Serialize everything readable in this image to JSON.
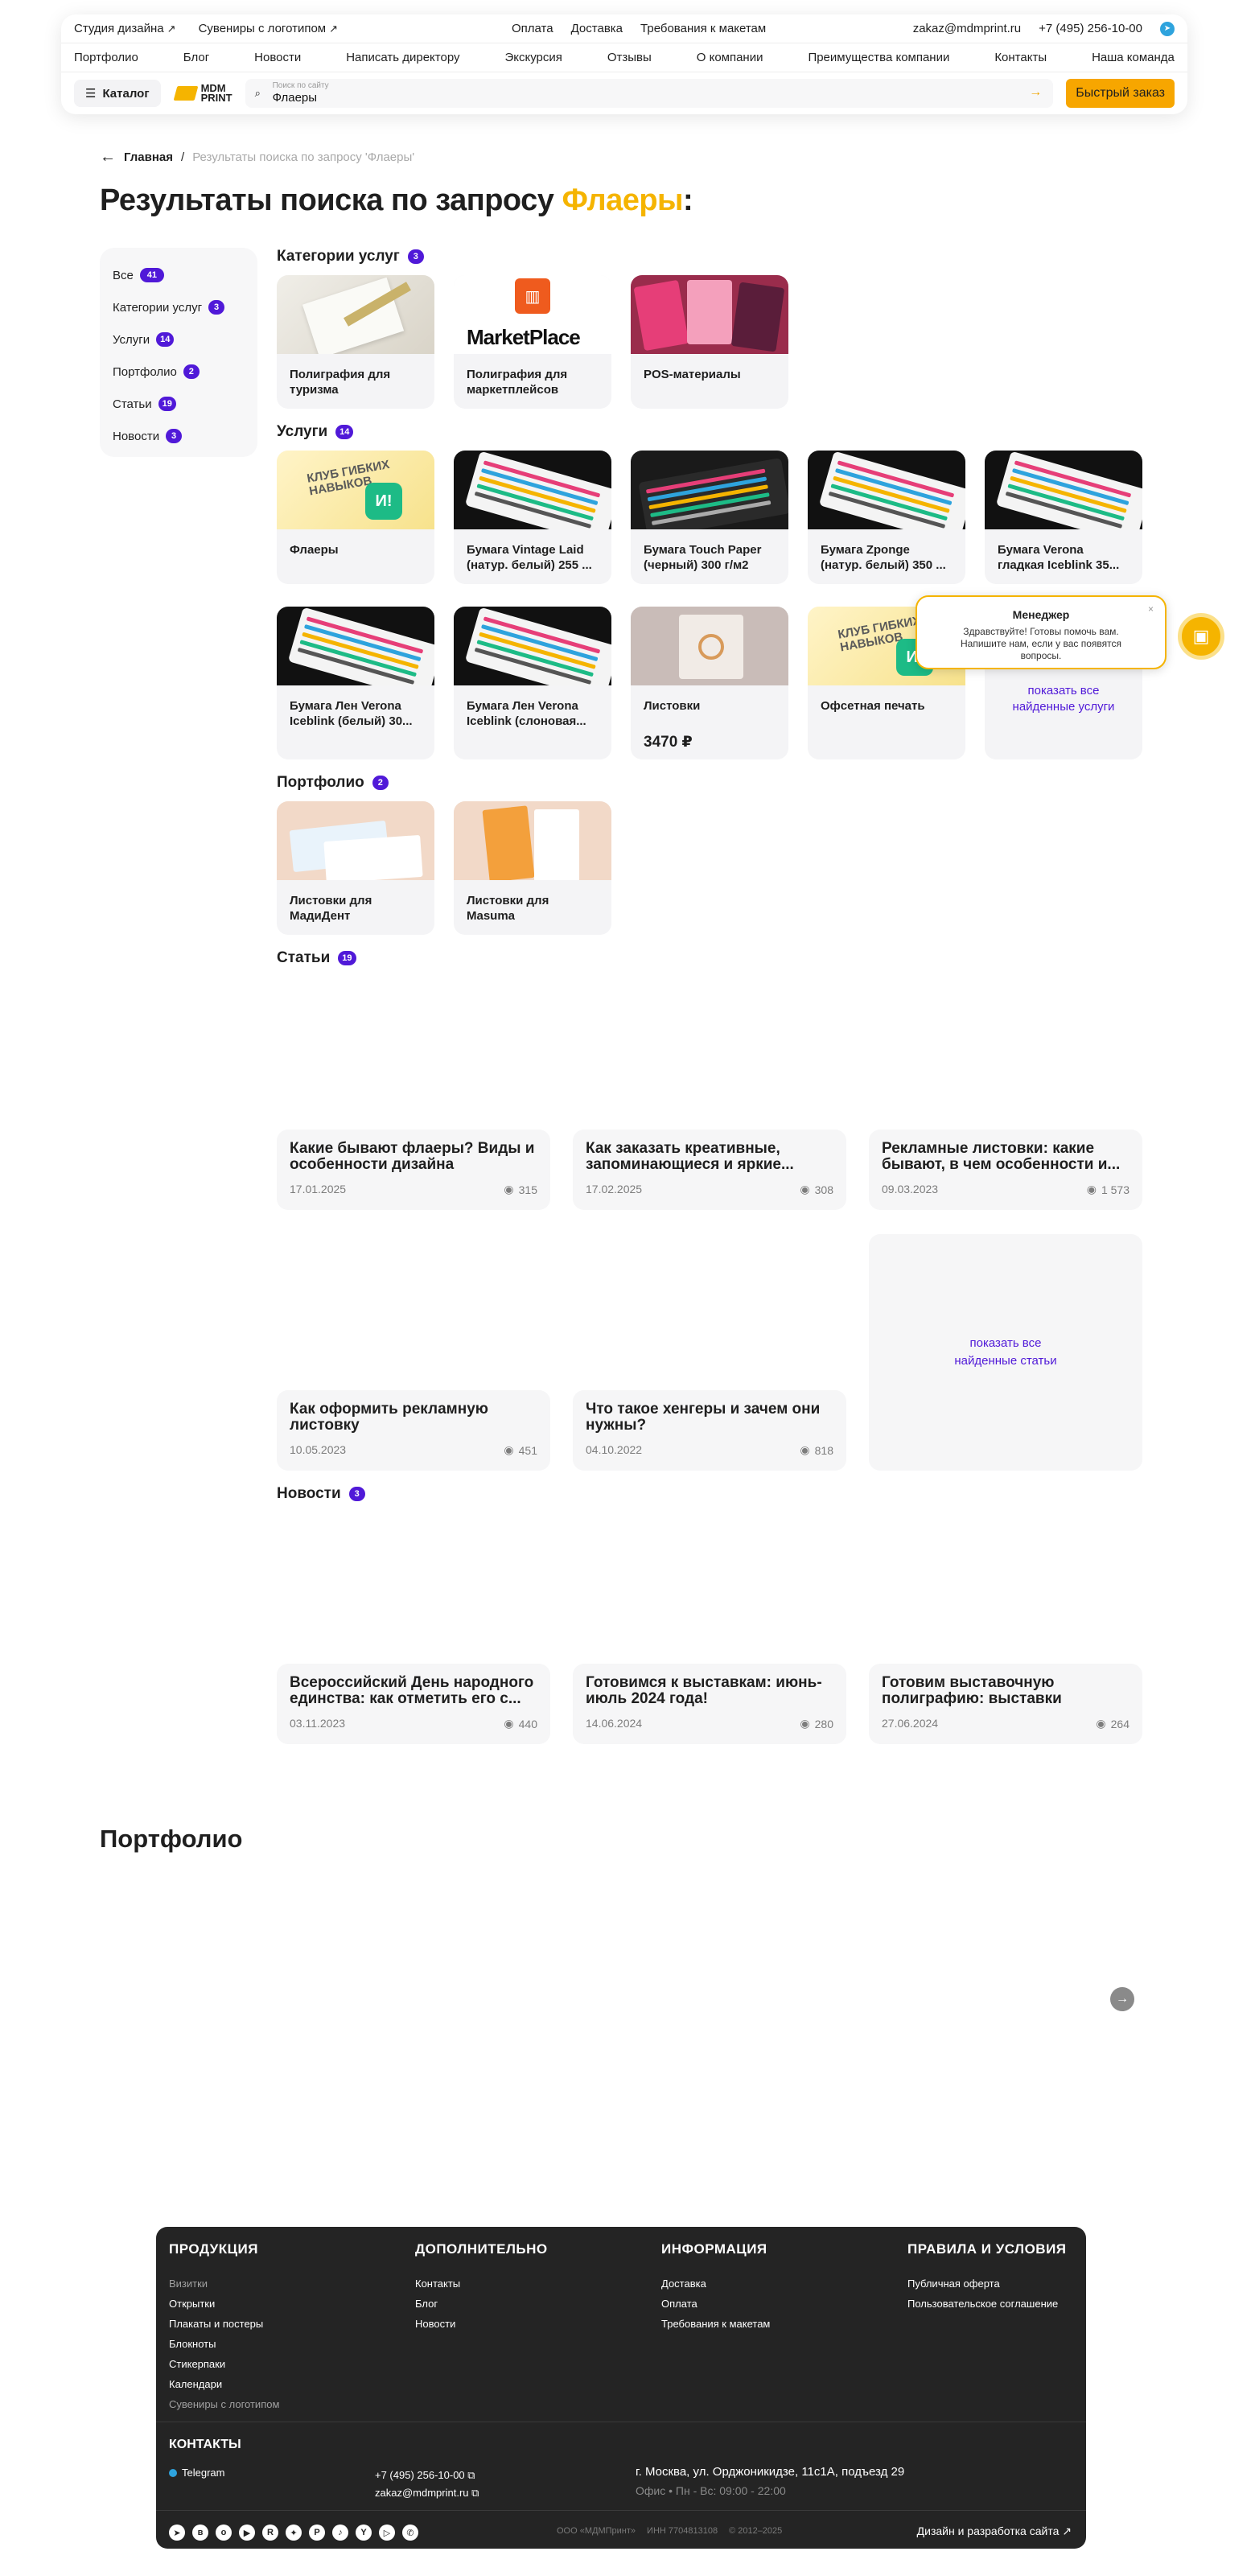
{
  "header": {
    "top_links": [
      {
        "label": "Студия дизайна",
        "arrow": "↗"
      },
      {
        "label": "Сувениры с логотипом",
        "arrow": "↗"
      }
    ],
    "top_center": [
      "Оплата",
      "Доставка",
      "Требования к макетам"
    ],
    "email": "zakaz@mdmprint.ru",
    "phone": "+7 (495) 256-10-00",
    "telegram_icon": "telegram-icon",
    "nav": [
      "Портфолио",
      "Блог",
      "Новости",
      "Написать директору",
      "Экскурсия",
      "Отзывы",
      "О компании",
      "Преимущества компании",
      "Контакты",
      "Наша команда"
    ],
    "catalog_label": "Каталог",
    "logo_text_1": "MDM",
    "logo_text_2": "PRINT",
    "search_placeholder": "Поиск по сайту",
    "search_value": "Флаеры",
    "quick_order_label": "Быстрый заказ",
    "accent_color": "#f7a600"
  },
  "breadcrumb": {
    "home": "Главная",
    "separator": "/",
    "current": "Результаты поиска по запросу 'Флаеры'"
  },
  "title": {
    "prefix": "Результаты поиска по запросу ",
    "query": "Флаеры",
    "suffix": ":"
  },
  "filters": [
    {
      "label": "Все",
      "count": "41"
    },
    {
      "label": "Категории услуг",
      "count": "3"
    },
    {
      "label": "Услуги",
      "count": "14"
    },
    {
      "label": "Портфолио",
      "count": "2"
    },
    {
      "label": "Статьи",
      "count": "19"
    },
    {
      "label": "Новости",
      "count": "3"
    }
  ],
  "categories": {
    "title": "Категории услуг",
    "count": "3",
    "items": [
      {
        "label": "Полиграфия для туризма"
      },
      {
        "label": "Полиграфия для маркетплейсов",
        "logo_text": "MarketPlace"
      },
      {
        "label": "POS-материалы"
      }
    ]
  },
  "services": {
    "title": "Услуги",
    "count": "14",
    "items": [
      {
        "label": "Флаеры"
      },
      {
        "label": "Бумага Vintage Laid (натур. белый) 255 ..."
      },
      {
        "label": "Бумага Touch Paper (черный) 300 г/м2"
      },
      {
        "label": "Бумага Zponge (натур. белый) 350 ..."
      },
      {
        "label": "Бумага Verona гладкая Iceblink 35..."
      },
      {
        "label": "Бумага Лен Verona Iceblink (белый) 30..."
      },
      {
        "label": "Бумага Лен Verona Iceblink (слоновая..."
      },
      {
        "label": "Листовки",
        "price": "3470 ₽"
      },
      {
        "label": "Офсетная печать"
      }
    ],
    "more_label": "показать все найденные услуги",
    "club_text": "КЛУБ ГИБКИХ НАВЫКОВ",
    "badge_text": "И!"
  },
  "portfolio": {
    "title": "Портфолио",
    "count": "2",
    "items": [
      {
        "label": "Листовки для МадиДент"
      },
      {
        "label": "Листовки для Masuma"
      }
    ]
  },
  "articles": {
    "title": "Статьи",
    "count": "19",
    "items": [
      {
        "title": "Какие бывают флаеры? Виды и особенности дизайна",
        "date": "17.01.2025",
        "views": "315"
      },
      {
        "title": "Как заказать креативные, запоминающиеся и яркие...",
        "date": "17.02.2025",
        "views": "308"
      },
      {
        "title": "Рекламные листовки: какие бывают, в чем особенности и...",
        "date": "09.03.2023",
        "views": "1 573"
      },
      {
        "title": "Как оформить рекламную листовку",
        "date": "10.05.2023",
        "views": "451"
      },
      {
        "title": "Что такое хенгеры и зачем они нужны?",
        "date": "04.10.2022",
        "views": "818"
      }
    ],
    "more_label": "показать все найденные статьи"
  },
  "news": {
    "title": "Новости",
    "count": "3",
    "items": [
      {
        "title": "Всероссийский День народного единства: как отметить его с...",
        "date": "03.11.2023",
        "views": "440"
      },
      {
        "title": "Готовимся к выставкам: июнь-июль 2024 года!",
        "date": "14.06.2024",
        "views": "280"
      },
      {
        "title": "Готовим выставочную полиграфию: выставки августа...",
        "date": "27.06.2024",
        "views": "264"
      }
    ]
  },
  "chat": {
    "name": "Менеджер",
    "message": "Здравствуйте! Готовы помочь вам. Напишите нам, если у вас появятся вопросы.",
    "close": "×"
  },
  "portfolio_block": {
    "title": "Портфолио",
    "next_icon": "arrow-right-icon"
  },
  "footer": {
    "cols": [
      {
        "title": "ПРОДУКЦИЯ",
        "items": [
          "Визитки",
          "Открытки",
          "Плакаты и постеры",
          "Блокноты",
          "Стикерпаки",
          "Календари",
          "Сувениры с логотипом"
        ]
      },
      {
        "title": "ДОПОЛНИТЕЛЬНО",
        "items": [
          "Контакты",
          "Блог",
          "Новости"
        ]
      },
      {
        "title": "ИНФОРМАЦИЯ",
        "items": [
          "Доставка",
          "Оплата",
          "Требования к макетам"
        ]
      },
      {
        "title": "ПРАВИЛА И УСЛОВИЯ",
        "items": [
          "Публичная оферта",
          "Пользовательское соглашение"
        ]
      }
    ],
    "contacts_title": "КОНТАКТЫ",
    "telegram": "Telegram",
    "phone": "+7 (495) 256-10-00",
    "email": "zakaz@mdmprint.ru",
    "address": "г. Москва, ул. Орджоникидзе, 11с1А, подъезд 29",
    "hours": "Офис • Пн - Вс: 09:00 - 22:00",
    "company": "ООО «МДМПринт»",
    "inn": "ИНН 7704813108",
    "years": "© 2012–2025",
    "dev": "Дизайн и разработка сайта",
    "social_icons": [
      "telegram-icon",
      "vk-icon",
      "ok-icon",
      "youtube-icon",
      "rutube-icon",
      "dzen-icon",
      "pinterest-icon",
      "tiktok-icon",
      "yappy-icon",
      "vk-video-icon",
      "whatsapp-icon"
    ]
  }
}
